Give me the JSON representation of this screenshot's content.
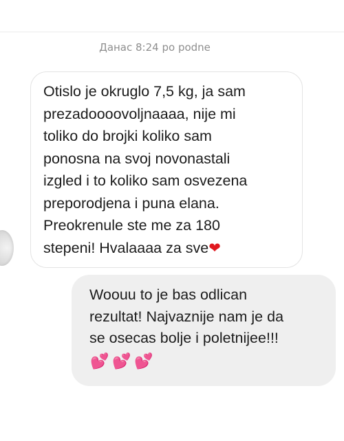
{
  "header": {
    "timestamp": "Данас 8:24 po podne"
  },
  "messages": {
    "received": {
      "text": "Otislo je okruglo 7,5 kg, ja sam\nprezadoooovoljnaaaa, nije mi\ntoliko do brojki koliko sam\nponosna na svoj novonastali\nizgled i to koliko sam osvezena\npreporodjena i puna elana.\nPreokrenule ste me za 180\nstepeni! Hvalaaaa za sve",
      "emoji": "❤"
    },
    "sent": {
      "text": "Woouu to je bas odlican\nrezultat! Najvaznije nam je da\nse osecas bolje i poletnijee!!!",
      "emojis": [
        "💕",
        "💕",
        "💕"
      ]
    }
  },
  "colors": {
    "received_bubble_bg": "#ffffff",
    "sent_bubble_bg": "#efefef",
    "timestamp_text": "#8e8e8e",
    "heart": "#e0181f",
    "pink_hearts": "#ff4fa0"
  }
}
